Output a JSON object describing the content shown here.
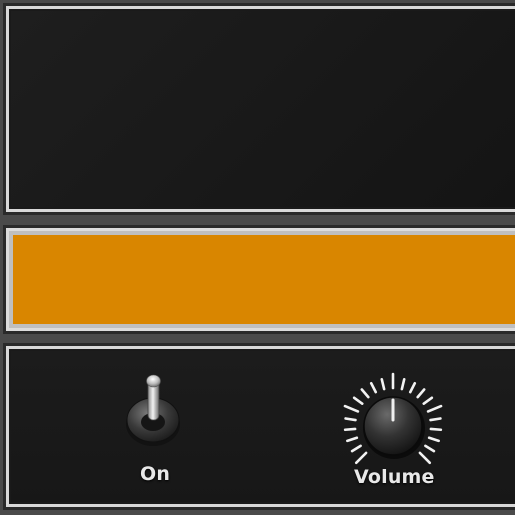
{
  "controls": {
    "power": {
      "label": "On",
      "state": "on"
    },
    "volume": {
      "label": "Volume"
    }
  },
  "colors": {
    "accent": "#d98600",
    "panel_bg": "#1b1b1b",
    "frame": "#d9d9d9",
    "label": "#e8e8e8"
  }
}
